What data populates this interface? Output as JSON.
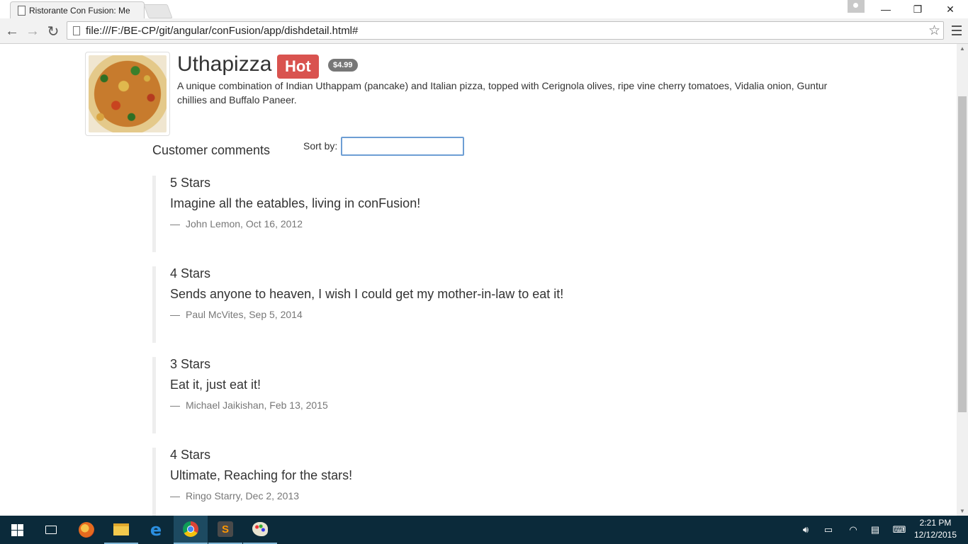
{
  "browser": {
    "tab_title": "Ristorante Con Fusion: Me",
    "url": "file:///F:/BE-CP/git/angular/conFusion/app/dishdetail.html#",
    "back_icon": "←",
    "forward_icon": "→",
    "reload_icon": "↻",
    "bookmark_icon": "☆",
    "minimize_icon": "—",
    "restore_icon": "❐",
    "close_icon": "✕"
  },
  "dish": {
    "name": "Uthapizza",
    "label": "Hot",
    "price": "$4.99",
    "description": "A unique combination of Indian Uthappam (pancake) and Italian pizza, topped with Cerignola olives, ripe vine cherry tomatoes, Vidalia onion, Guntur chillies and Buffalo Paneer."
  },
  "comments_section": {
    "title": "Customer comments",
    "sort_label": "Sort by:",
    "sort_value": ""
  },
  "comments": [
    {
      "rating": "5 Stars",
      "text": "Imagine all the eatables, living in conFusion!",
      "author_date": "John Lemon, Oct 16, 2012"
    },
    {
      "rating": "4 Stars",
      "text": "Sends anyone to heaven, I wish I could get my mother-in-law to eat it!",
      "author_date": "Paul McVites, Sep 5, 2014"
    },
    {
      "rating": "3 Stars",
      "text": "Eat it, just eat it!",
      "author_date": "Michael Jaikishan, Feb 13, 2015"
    },
    {
      "rating": "4 Stars",
      "text": "Ultimate, Reaching for the stars!",
      "author_date": "Ringo Starry, Dec 2, 2013"
    }
  ],
  "footer_dash": "—",
  "taskbar": {
    "sublime_letter": "S",
    "edge_letter": "e",
    "time": "2:21 PM",
    "date": "12/12/2015"
  },
  "colors": {
    "hot_badge": "#d9534f",
    "price_badge": "#777777",
    "taskbar": "#0b2a3a"
  }
}
